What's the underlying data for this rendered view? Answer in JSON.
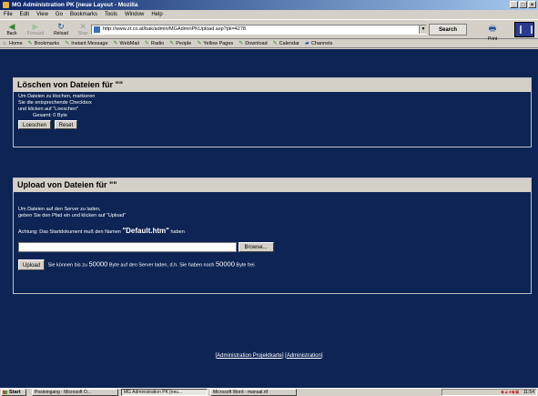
{
  "window": {
    "title": "MG Administration PK [neue Layout - Mozilla",
    "min": "_",
    "max": "□",
    "close": "×"
  },
  "menu": [
    "File",
    "Edit",
    "View",
    "Go",
    "Bookmarks",
    "Tools",
    "Window",
    "Help"
  ],
  "nav": {
    "back": "Back",
    "forward": "Forward",
    "reload": "Reload",
    "stop": "Stop",
    "url": "http://www.zt.co.at/bak/admin/MGAdminPKUpload.asp?pk=4278",
    "search": "Search",
    "print": "Print"
  },
  "personal_toolbar": [
    "Home",
    "Bookmarks",
    "Instant Message",
    "WebMail",
    "Radio",
    "People",
    "Yellow Pages",
    "Download",
    "Calendar",
    "Channels"
  ],
  "delete_section": {
    "heading": "Löschen von Dateien für \"\"",
    "line1": "Um Dateien zu löschen, markieren",
    "line2": "Sie die entsprechende Checkbox",
    "line3": "und klicken auf \"Loeschen\"",
    "total": "Gesamt: 0 Byte",
    "delete_button": "Loeschen",
    "reset_button": "Reset"
  },
  "upload_section": {
    "heading": "Upload von Dateien für \"\"",
    "line1": "Um Dateien auf den Server zu laden,",
    "line2": "geben Sie den Pfad ein und klicken auf \"Upload\"",
    "note_prefix": "Achtung: Das Startdokument muß den Namen",
    "note_name": "\"Default.htm\"",
    "note_suffix": "haben",
    "browse_button": "Browse...",
    "upload_button": "Upload",
    "limit_a": "Sie können bis zu",
    "limit_value": "50000",
    "limit_b": "Byte auf den Server laden, d.h. Sie haben noch",
    "free_value": "50000",
    "limit_c": "Byte frei"
  },
  "footer_links": {
    "open": "[",
    "link1": "Administration Projektkarte",
    "sep": "] [",
    "link2": "Administration",
    "close": "]"
  },
  "taskbar": {
    "start": "Start",
    "tasks": [
      "Posteingang - Microsoft O...",
      "MG Administration PK [neu...",
      "Microsoft Word - manual.rtf"
    ],
    "clock": "11:54"
  }
}
